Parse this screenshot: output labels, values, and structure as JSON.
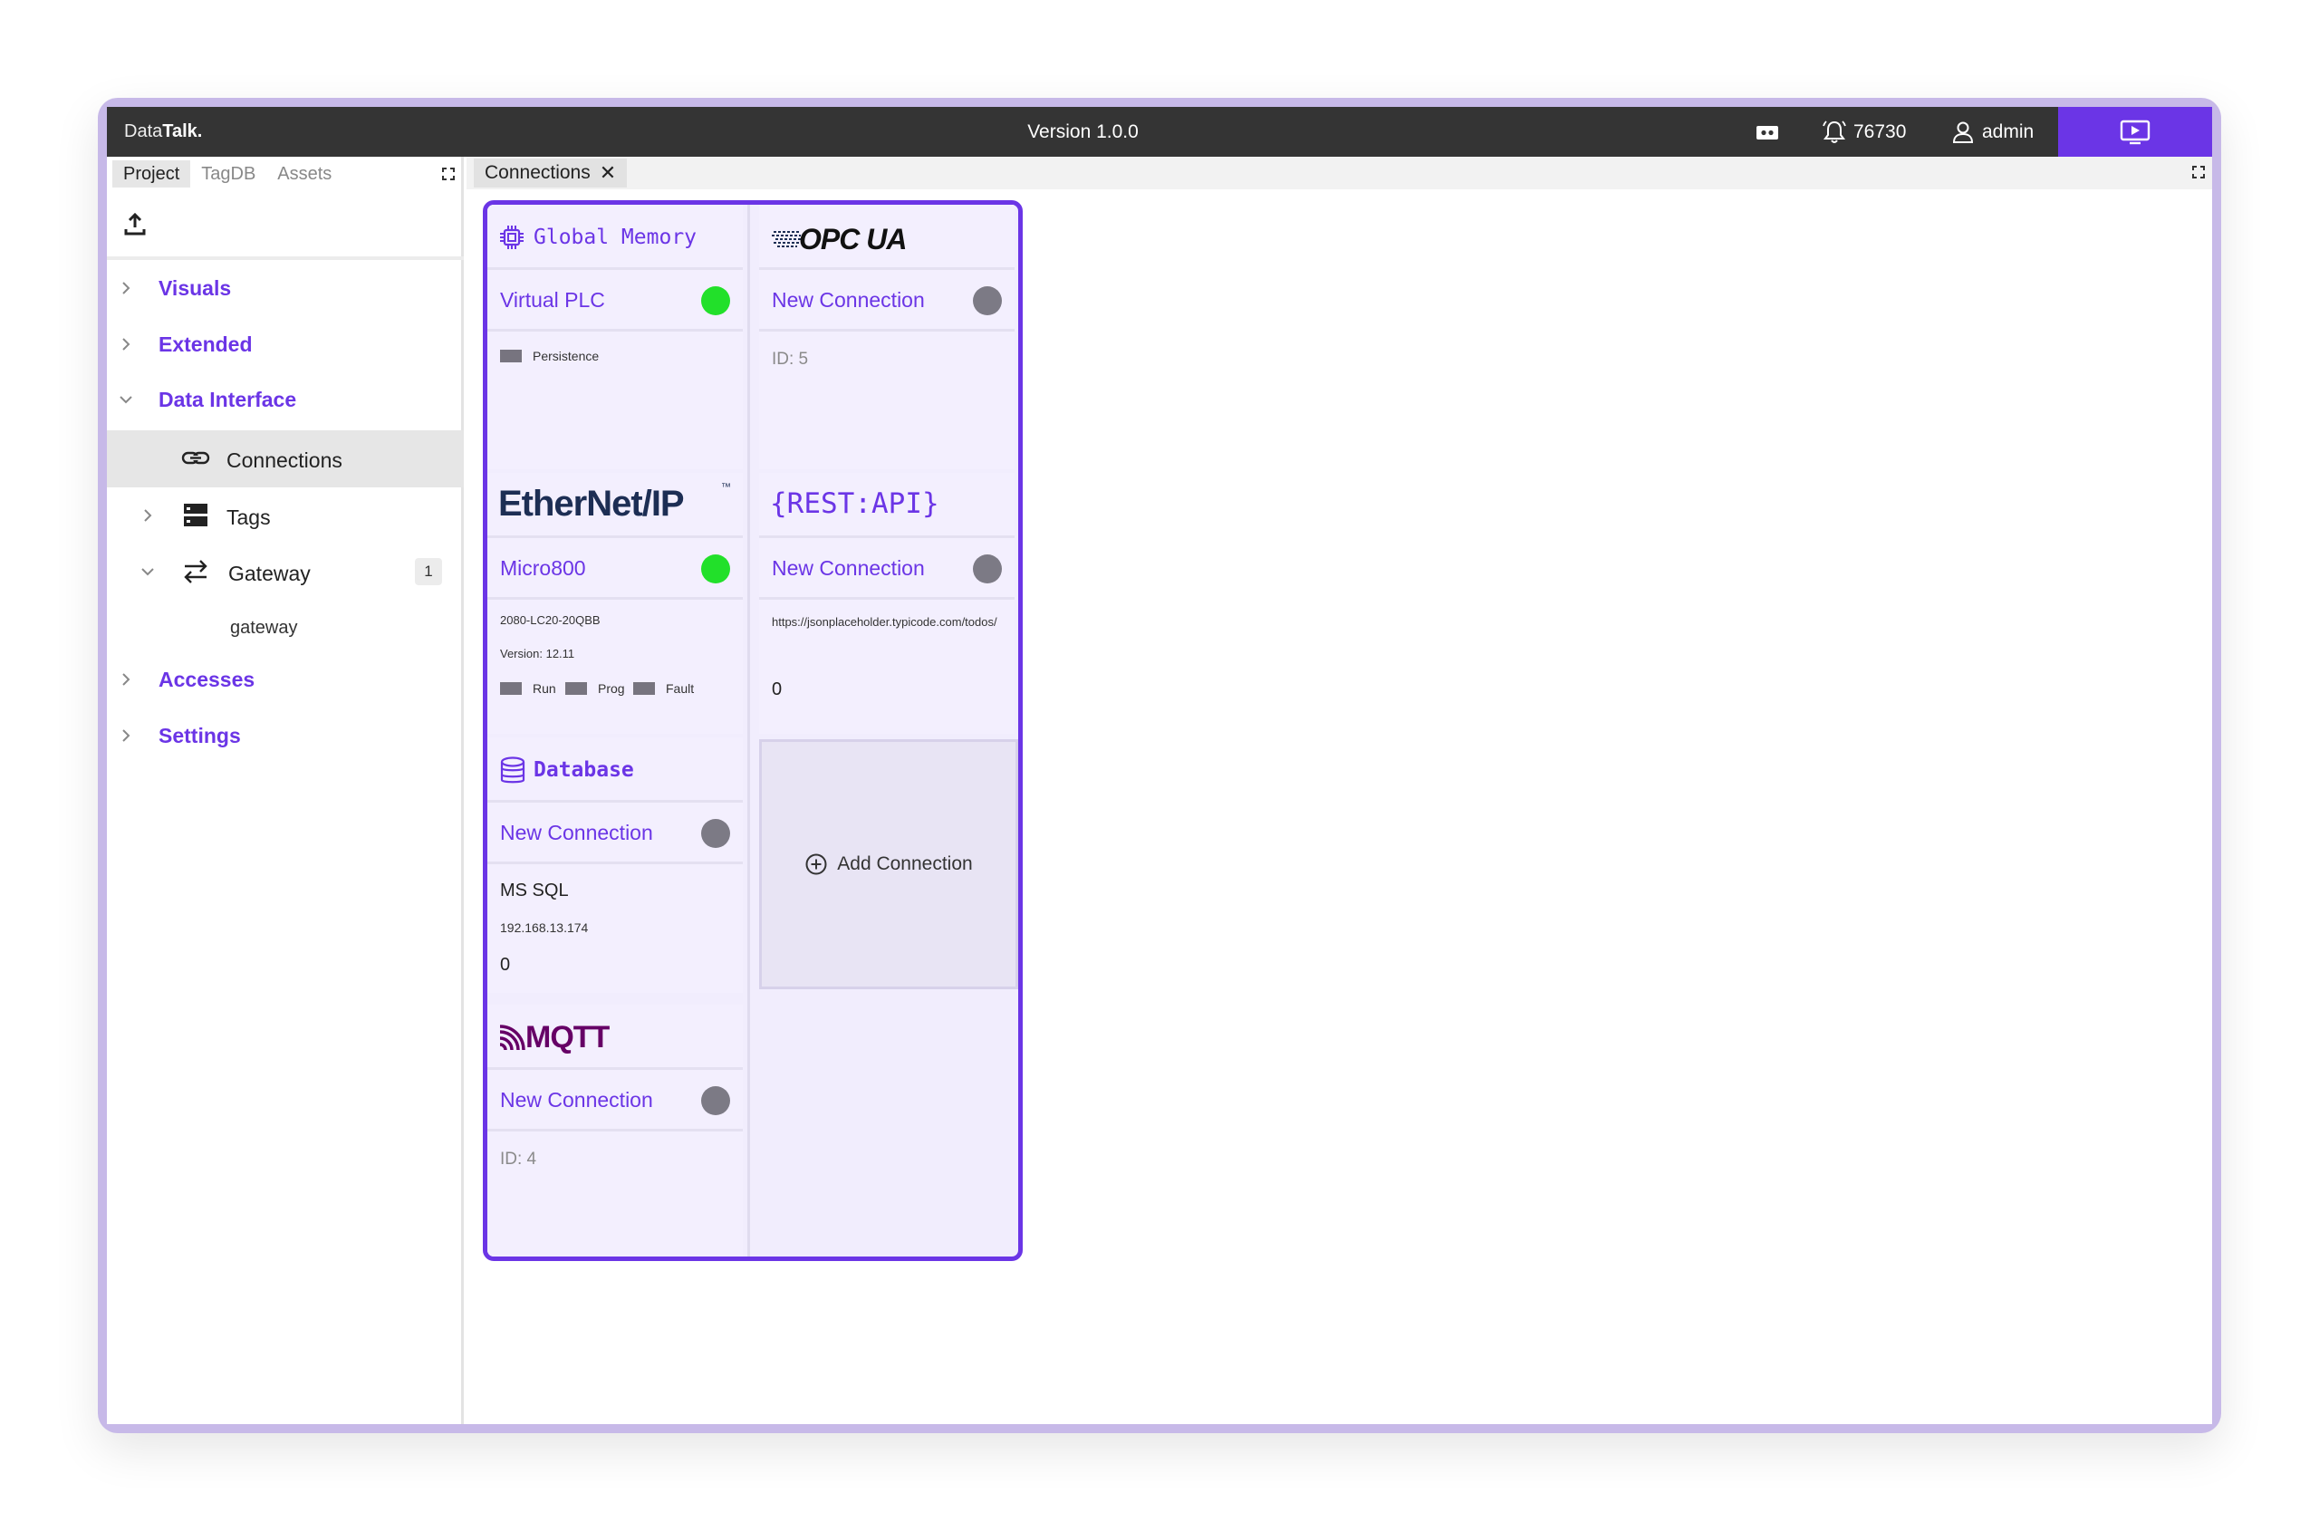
{
  "header": {
    "brand_prefix": "Data",
    "brand_suffix": "Talk.",
    "version": "Version 1.0.0",
    "notifications_count": "76730",
    "user_name": "admin"
  },
  "sidebar": {
    "tabs": [
      "Project",
      "TagDB",
      "Assets"
    ],
    "items": [
      {
        "label": "Visuals"
      },
      {
        "label": "Extended"
      },
      {
        "label": "Data Interface"
      },
      {
        "label": "Accesses"
      },
      {
        "label": "Settings"
      }
    ],
    "sub_items": [
      {
        "label": "Connections"
      },
      {
        "label": "Tags"
      },
      {
        "label": "Gateway",
        "badge": "1"
      }
    ],
    "gateway_child": "gateway"
  },
  "main": {
    "tab_label": "Connections",
    "tab_close": "✕",
    "add_connection": "Add Connection"
  },
  "cards": {
    "global_memory": {
      "title": "Global Memory",
      "name": "Virtual PLC",
      "status": "connected",
      "legend": [
        "Persistence"
      ]
    },
    "opcua": {
      "logo_text": "OPC UA",
      "name": "New Connection",
      "status": "disconnected",
      "detail": "ID: 5"
    },
    "ethernet_ip": {
      "logo_text": "EtherNet/IP",
      "tm": "™",
      "name": "Micro800",
      "status": "connected",
      "model": "2080-LC20-20QBB",
      "version": "Version: 12.11",
      "legend": [
        "Run",
        "Prog",
        "Fault"
      ]
    },
    "rest_api": {
      "logo_text": "{REST:API}",
      "name": "New Connection",
      "status": "disconnected",
      "url": "https://jsonplaceholder.typicode.com/todos/",
      "value": "0"
    },
    "database": {
      "title": "Database",
      "name": "New Connection",
      "status": "disconnected",
      "engine": "MS SQL",
      "host": "192.168.13.174",
      "value": "0"
    },
    "mqtt": {
      "logo_text": "MQTT",
      "name": "New Connection",
      "status": "disconnected",
      "detail": "ID: 4"
    }
  },
  "colors": {
    "accent": "#6b35e6",
    "topbar": "#343434",
    "online": "#22e02a",
    "offline": "#7c7a85",
    "ethernet_navy": "#1d2e54",
    "mqtt_purple": "#660066"
  },
  "icons": [
    "camera-icon",
    "bell-icon",
    "user-icon",
    "present-icon",
    "upload-icon",
    "link-icon",
    "server-icon",
    "swap-icon",
    "chip-icon",
    "database-icon",
    "plus-circle-icon",
    "mqtt-icon"
  ]
}
